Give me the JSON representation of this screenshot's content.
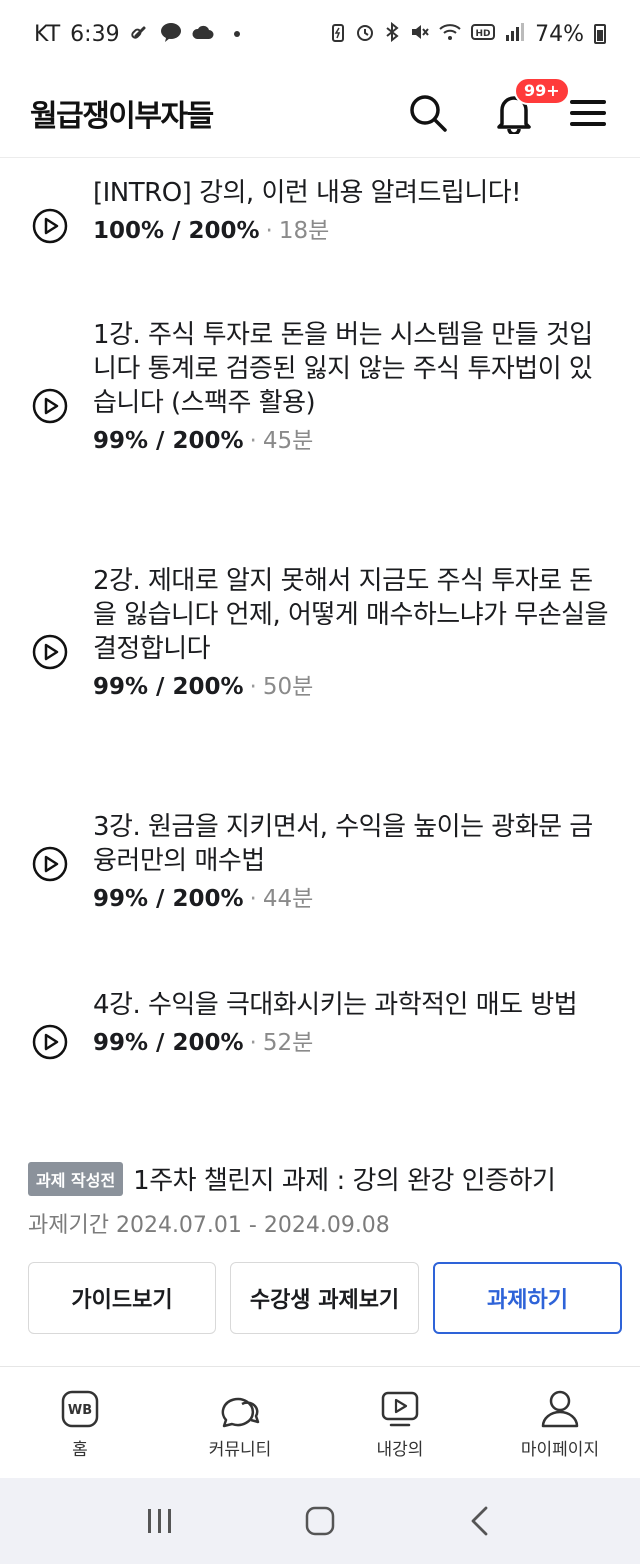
{
  "status_bar": {
    "carrier": "KT",
    "time": "6:39",
    "battery": "74%"
  },
  "header": {
    "logo": "월급쟁이부자들",
    "notification_badge": "99+"
  },
  "lectures": [
    {
      "title": "[INTRO] 강의, 이런 내용 알려드립니다!",
      "progress": "100% / 200%",
      "duration": "18분"
    },
    {
      "title": "1강. 주식 투자로 돈을 버는 시스템을 만들 것입니다 통계로 검증된 잃지 않는 주식 투자법이 있습니다 (스팩주 활용)",
      "progress": "99% / 200%",
      "duration": "45분"
    },
    {
      "title": "2강. 제대로 알지 못해서 지금도 주식 투자로 돈을 잃습니다 언제, 어떻게 매수하느냐가 무손실을 결정합니다",
      "progress": "99% / 200%",
      "duration": "50분"
    },
    {
      "title": "3강. 원금을 지키면서, 수익을 높이는 광화문 금융러만의 매수법",
      "progress": "99% / 200%",
      "duration": "44분"
    },
    {
      "title": "4강. 수익을 극대화시키는 과학적인 매도 방법",
      "progress": "99% / 200%",
      "duration": "52분"
    }
  ],
  "meta_separator": "·",
  "assignment": {
    "status_badge": "과제 작성전",
    "title": "1주차 챌린지 과제 : 강의 완강 인증하기",
    "period": "과제기간 2024.07.01 - 2024.09.08",
    "buttons": {
      "guide": "가이드보기",
      "peer": "수강생 과제보기",
      "submit": "과제하기"
    }
  },
  "bottom_nav": [
    {
      "label": "홈",
      "icon": "wb-home-icon"
    },
    {
      "label": "커뮤니티",
      "icon": "chat-bubbles-icon"
    },
    {
      "label": "내강의",
      "icon": "video-play-icon"
    },
    {
      "label": "마이페이지",
      "icon": "person-icon"
    }
  ],
  "colors": {
    "accent": "#2e63d8",
    "badge_red": "#ff3b3b",
    "status_badge_bg": "#8b929b"
  }
}
